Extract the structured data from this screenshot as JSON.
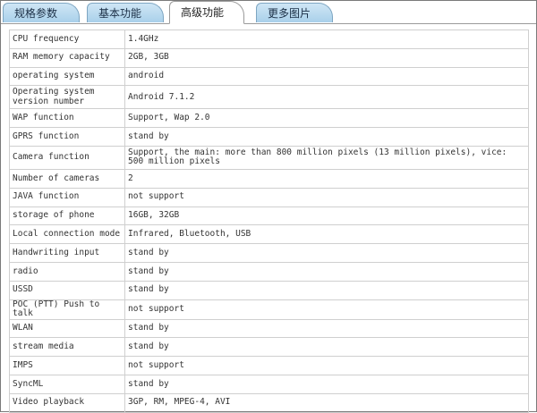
{
  "tabs": [
    {
      "label": "规格参数",
      "active": false
    },
    {
      "label": "基本功能",
      "active": false
    },
    {
      "label": "高级功能",
      "active": true
    },
    {
      "label": "更多图片",
      "active": false
    }
  ],
  "rows": [
    {
      "key": "CPU frequency",
      "value": "1.4GHz"
    },
    {
      "key": "RAM memory capacity",
      "value": "2GB, 3GB"
    },
    {
      "key": "operating system",
      "value": "android"
    },
    {
      "key": "Operating system version number",
      "value": "Android 7.1.2"
    },
    {
      "key": "WAP function",
      "value": "Support, Wap 2.0"
    },
    {
      "key": "GPRS function",
      "value": "stand by"
    },
    {
      "key": "Camera function",
      "value": "Support, the main: more than 800 million pixels (13 million pixels), vice: 500 million pixels"
    },
    {
      "key": "Number of cameras",
      "value": "2"
    },
    {
      "key": "JAVA function",
      "value": "not support"
    },
    {
      "key": "storage of phone",
      "value": "16GB, 32GB"
    },
    {
      "key": "Local connection mode",
      "value": "Infrared, Bluetooth, USB"
    },
    {
      "key": "Handwriting input",
      "value": "stand by"
    },
    {
      "key": "radio",
      "value": "stand by"
    },
    {
      "key": "USSD",
      "value": "stand by"
    },
    {
      "key": "POC (PTT) Push to talk",
      "value": "not support"
    },
    {
      "key": "WLAN",
      "value": "stand by"
    },
    {
      "key": "stream media",
      "value": "stand by"
    },
    {
      "key": "IMPS",
      "value": "not support"
    },
    {
      "key": "SyncML",
      "value": "stand by"
    },
    {
      "key": "Video playback",
      "value": "3GP, RM, MPEG-4, AVI"
    }
  ]
}
